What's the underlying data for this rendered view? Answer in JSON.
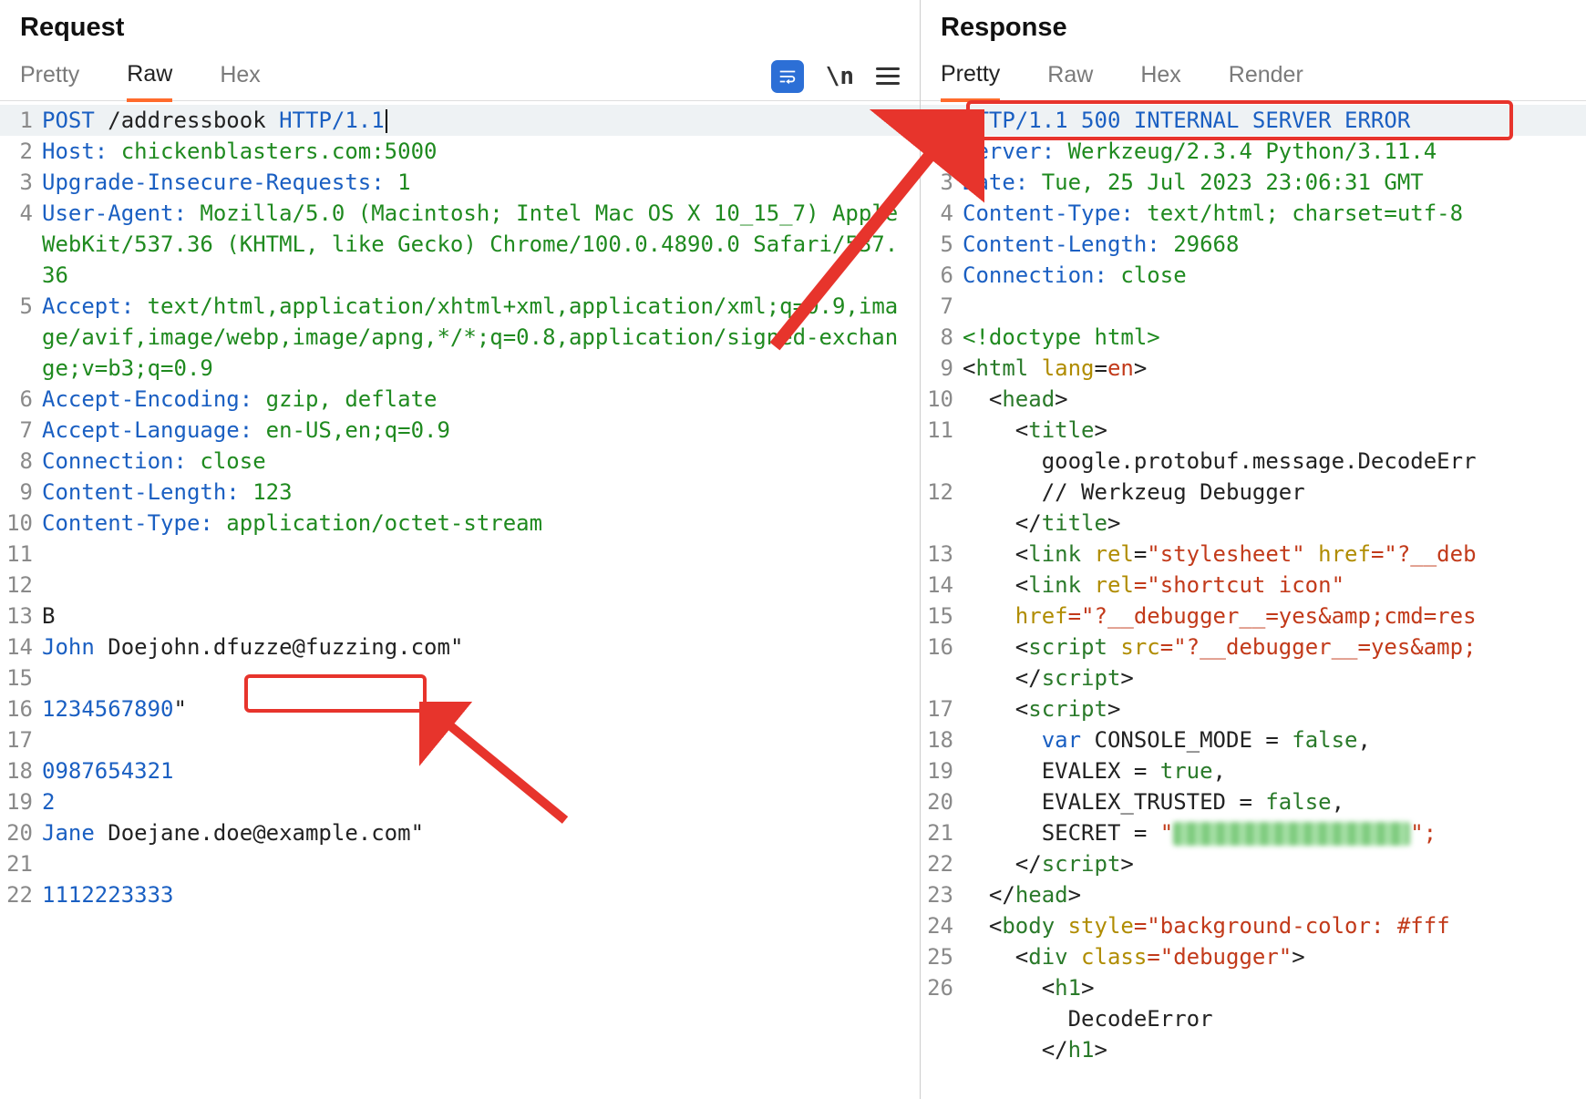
{
  "request": {
    "title": "Request",
    "tabs": {
      "pretty": "Pretty",
      "raw": "Raw",
      "hex": "Hex"
    },
    "actions": {
      "toggle_n": "\\n"
    },
    "lines": {
      "l1_method": "POST",
      "l1_path": " /addressbook ",
      "l1_proto": "HTTP/1.1",
      "l2_k": "Host:",
      "l2_v": " chickenblasters.com:5000",
      "l3_k": "Upgrade-Insecure-Requests:",
      "l3_v": " 1",
      "l4_k": "User-Agent:",
      "l4_v": " Mozilla/5.0 (Macintosh; Intel Mac OS X 10_15_7) AppleWebKit/537.36 (KHTML, like Gecko) Chrome/100.0.4890.0 Safari/537.36",
      "l5_k": "Accept:",
      "l5_v": " text/html,application/xhtml+xml,application/xml;q=0.9,image/avif,image/webp,image/apng,*/*;q=0.8,application/signed-exchange;v=b3;q=0.9",
      "l6_k": "Accept-Encoding:",
      "l6_v": " gzip, deflate",
      "l7_k": "Accept-Language:",
      "l7_v": " en-US,en;q=0.9",
      "l8_k": "Connection:",
      "l8_v": " close",
      "l9_k": "Content-Length:",
      "l9_v": " 123",
      "l10_k": "Content-Type:",
      "l10_v": " application/octet-stream",
      "l13": "B",
      "l14_a": "John",
      "l14_b": " Doejohn.d",
      "l14_c": "fuzze@fuzzing",
      "l14_d": ".com\"",
      "l16": "1234567890",
      "l16_q": "\"",
      "l18": "0987654321",
      "l19": "2",
      "l20_a": "Jane",
      "l20_b": " Doejane.doe@example.com\"",
      "l22": "1112223333"
    }
  },
  "response": {
    "title": "Response",
    "tabs": {
      "pretty": "Pretty",
      "raw": "Raw",
      "hex": "Hex",
      "render": "Render"
    },
    "lines": {
      "l1_proto": "HTTP/1.1 ",
      "l1_status": "500 INTERNAL SERVER ERROR",
      "l2_k": "Server:",
      "l2_v": " Werkzeug/2.3.4 Python/3.11.4",
      "l3_k": "Date:",
      "l3_v": " Tue, 25 Jul 2023 23:06:31 GMT",
      "l4_k": "Content-Type:",
      "l4_v": " text/html; charset=utf-8",
      "l5_k": "Content-Length:",
      "l5_v": " 29668",
      "l6_k": "Connection:",
      "l6_v": " close",
      "l8": "<!doctype html>",
      "l9_open": "<",
      "l9_tag": "html",
      "l9_attr": " lang",
      "l9_eq": "=",
      "l9_val": "en",
      "l9_close": ">",
      "l10_open": "  <",
      "l10_tag": "head",
      "l10_close": ">",
      "l11_open": "    <",
      "l11_tag": "title",
      "l11_close": ">",
      "l11b": "      google.protobuf.message.DecodeErr",
      "l12": "      // Werkzeug Debugger",
      "l12b_open": "    </",
      "l12b_tag": "title",
      "l12b_close": ">",
      "l13_open": "    <",
      "l13_tag": "link",
      "l13_a1": " rel",
      "l13_e": "=",
      "l13_v1": "\"stylesheet\"",
      "l13_a2": " href",
      "l13_v2": "=\"?__deb",
      "l14_open": "    <",
      "l14_tag": "link",
      "l14_a1": " rel",
      "l14_v1": "=\"shortcut icon\"",
      "l15_a": "    href",
      "l15_v": "=\"?__debugger__=yes&amp;cmd=res",
      "l16_open": "    <",
      "l16_tag": "script",
      "l16_a": " src",
      "l16_v": "=\"?__debugger__=yes&amp;",
      "l16b_open": "    </",
      "l16b_tag": "script",
      "l16b_close": ">",
      "l17_open": "    <",
      "l17_tag": "script",
      "l17_close": ">",
      "l18_kw": "      var",
      "l18_rest": " CONSOLE_MODE = ",
      "l18_val": "false",
      "l18_c": ",",
      "l19_rest": "      EVALEX = ",
      "l19_val": "true",
      "l19_c": ",",
      "l20_rest": "      EVALEX_TRUSTED = ",
      "l20_val": "false",
      "l20_c": ",",
      "l21_rest": "      SECRET = ",
      "l21_q1": "\"",
      "l21_q2": "\";",
      "l22_open": "    </",
      "l22_tag": "script",
      "l22_close": ">",
      "l23_open": "  </",
      "l23_tag": "head",
      "l23_close": ">",
      "l24_open": "  <",
      "l24_tag": "body",
      "l24_a": " style",
      "l24_v": "=\"background-color: #fff",
      "l25_open": "    <",
      "l25_tag": "div",
      "l25_a": " class",
      "l25_v": "=\"debugger\"",
      "l25_close": ">",
      "l26_open": "      <",
      "l26_tag": "h1",
      "l26_close": ">",
      "l26b": "        DecodeError",
      "l26c_open": "      </",
      "l26c_tag": "h1",
      "l26c_close": ">"
    }
  }
}
